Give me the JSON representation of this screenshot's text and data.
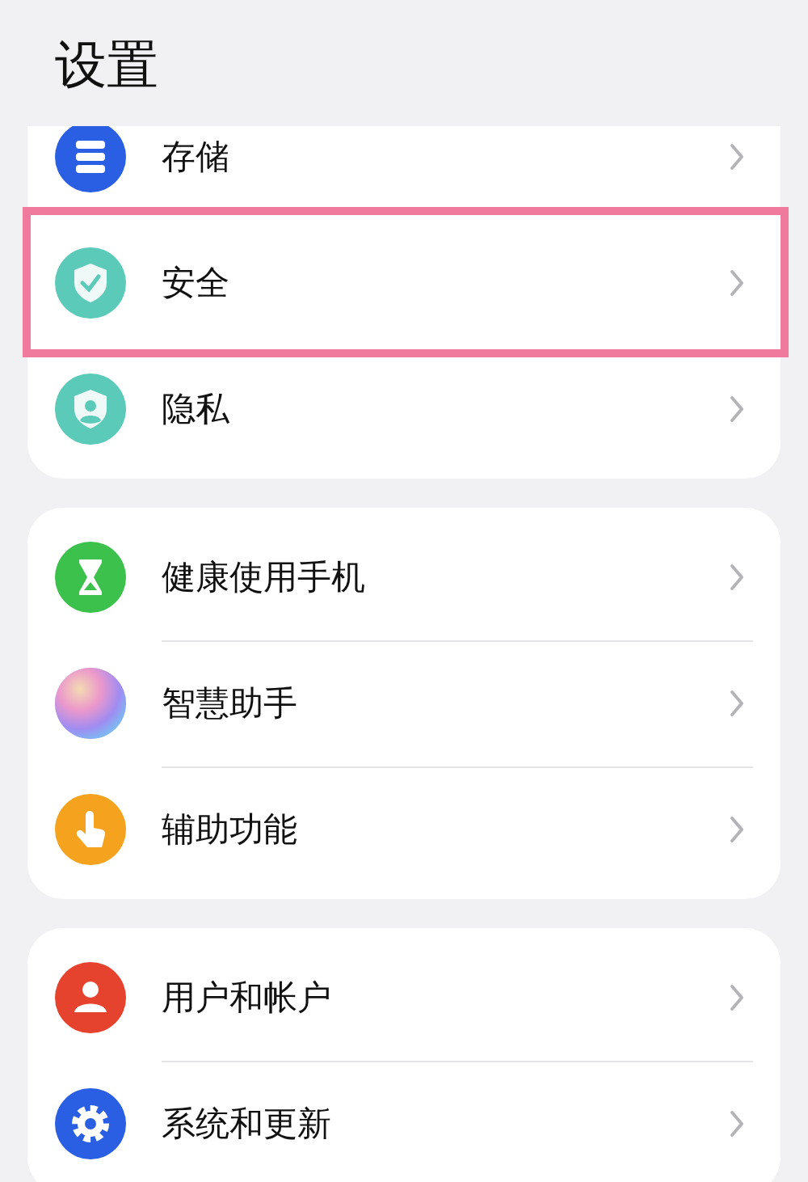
{
  "title": "设置",
  "groups": [
    {
      "dividers": false,
      "items": [
        {
          "label": "存储",
          "color": "#2b5fe3",
          "highlighted": false
        },
        {
          "label": "安全",
          "color": "#5ccab9",
          "highlighted": true
        },
        {
          "label": "隐私",
          "color": "#5ccab9",
          "highlighted": false
        }
      ]
    },
    {
      "dividers": true,
      "items": [
        {
          "label": "健康使用手机",
          "color": "#3cc24c",
          "highlighted": false
        },
        {
          "label": "智慧助手",
          "color": "#b48cf0",
          "highlighted": false
        },
        {
          "label": "辅助功能",
          "color": "#f5a21e",
          "highlighted": false
        }
      ]
    },
    {
      "dividers": true,
      "items": [
        {
          "label": "用户和帐户",
          "color": "#e6432f",
          "highlighted": false
        },
        {
          "label": "系统和更新",
          "color": "#2b5fe3",
          "highlighted": false
        }
      ]
    }
  ]
}
